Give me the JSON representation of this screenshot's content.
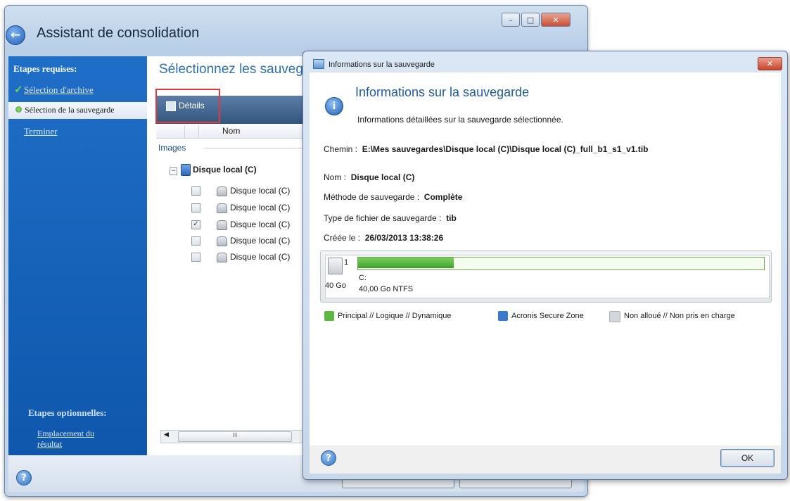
{
  "main_window": {
    "title": "Assistant de consolidation",
    "controls": {
      "minimize": "–",
      "maximize": "□",
      "close": "✕"
    }
  },
  "sidebar": {
    "required_heading": "Etapes requises:",
    "steps": [
      {
        "label": "Sélection d'archive",
        "state": "done"
      },
      {
        "label": "Sélection de la sauvegarde",
        "state": "current"
      },
      {
        "label": "Terminer",
        "state": "pending"
      }
    ],
    "optional_heading": "Etapes optionnelles:",
    "optional_steps": [
      {
        "label_line1": "Emplacement du",
        "label_line2": "résultat"
      }
    ]
  },
  "content": {
    "subtitle": "Sélectionnez les sauveg",
    "toolbar": {
      "details_label": "Détails"
    },
    "columns": [
      "Nom"
    ],
    "group_label": "Images",
    "tree_root": "Disque local (C)",
    "tree_items": [
      {
        "label": "Disque local (C)",
        "checked": false
      },
      {
        "label": "Disque local (C)",
        "checked": false
      },
      {
        "label": "Disque local (C)",
        "checked": true
      },
      {
        "label": "Disque local (C)",
        "checked": false
      },
      {
        "label": "Disque local (C)",
        "checked": false
      }
    ],
    "scroll_grip": "III"
  },
  "dialog": {
    "window_title": "Informations sur la sauvegarde",
    "close_glyph": "✕",
    "heading": "Informations sur la sauvegarde",
    "description": "Informations détaillées sur la sauvegarde sélectionnée.",
    "fields": {
      "path_label": "Chemin :",
      "path_value": "E:\\Mes sauvegardes\\Disque local (C)\\Disque local (C)_full_b1_s1_v1.tib",
      "name_label": "Nom :",
      "name_value": "Disque local (C)",
      "method_label": "Méthode de sauvegarde :",
      "method_value": "Complète",
      "filetype_label": "Type de fichier de sauvegarde :",
      "filetype_value": "tib",
      "created_label": "Créée le :",
      "created_value": "26/03/2013 13:38:26"
    },
    "disk": {
      "number": "1",
      "size": "40 Go",
      "partition_name": "C:",
      "partition_info": "40,00 Go  NTFS",
      "used_fraction": 0.235
    },
    "legend": [
      {
        "label": "Principal // Logique // Dynamique",
        "color": "#5cb842"
      },
      {
        "label": "Acronis Secure Zone",
        "color": "#3a78cc"
      },
      {
        "label": "Non alloué // Non pris en charge",
        "color": "#d3d6da"
      }
    ],
    "ok_label": "OK",
    "help_glyph": "?"
  },
  "colors": {
    "sidebar_blue": "#1463be",
    "accent_blue": "#1f5aa6",
    "highlight_red": "#e03a3a"
  }
}
